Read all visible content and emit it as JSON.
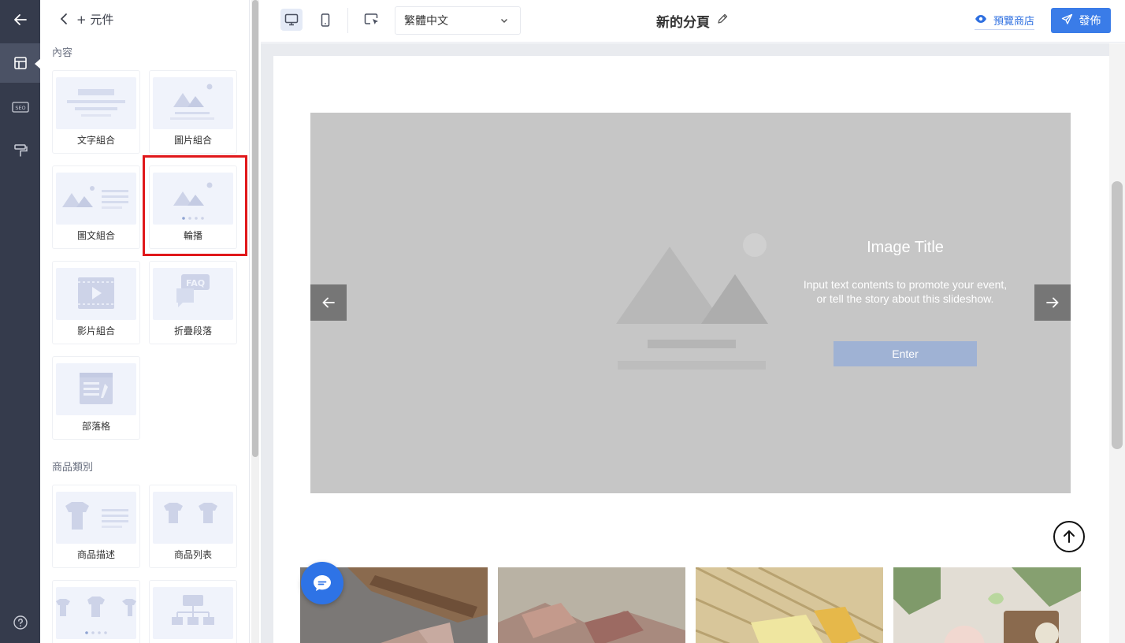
{
  "rail": {
    "items": [
      "back-arrow-icon",
      "layout-icon",
      "seo-icon",
      "paint-roller-icon"
    ],
    "seo_text": "SEO",
    "help_icon": "help-icon"
  },
  "panel": {
    "title": "+ 元件",
    "section_content": "內容",
    "section_products": "商品類別",
    "cards": {
      "text_group": "文字組合",
      "image_group": "圖片組合",
      "image_text": "圖文組合",
      "carousel": "輪播",
      "video_group": "影片組合",
      "faq": "折疊段落",
      "blog": "部落格",
      "product_desc": "商品描述",
      "product_list": "商品列表"
    },
    "faq_badge": "FAQ"
  },
  "topbar": {
    "language": "繁體中文",
    "page_title": "新的分頁",
    "preview": "預覽商店",
    "publish": "發佈"
  },
  "slideshow": {
    "title": "Image Title",
    "text": "Input text contents to promote your event, or tell the story about this slideshow.",
    "button": "Enter"
  },
  "colors": {
    "rail": "#353b4c",
    "accent": "#3a7ce8",
    "highlight": "#e0181b",
    "slide_bg": "#c6c6c6"
  }
}
